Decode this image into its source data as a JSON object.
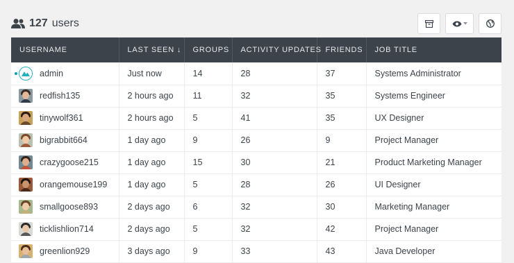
{
  "header": {
    "icon": "users-icon",
    "count": "127",
    "label": "users"
  },
  "toolbar": {
    "buttons": [
      {
        "icon": "archive-icon"
      },
      {
        "icon": "eye-dropdown-icon"
      },
      {
        "icon": "globe-icon"
      }
    ]
  },
  "table": {
    "columns": [
      "USERNAME",
      "LAST SEEN ↓",
      "GROUPS",
      "ACTIVITY UPDATES",
      "FRIENDS",
      "JOB TITLE"
    ],
    "rows": [
      {
        "username": "admin",
        "last_seen": "Just now",
        "groups": "14",
        "activity": "28",
        "friends": "37",
        "job": "Systems Administrator",
        "online": true,
        "avatar": "logo"
      },
      {
        "username": "redfish135",
        "last_seen": "2 hours ago",
        "groups": "11",
        "activity": "32",
        "friends": "35",
        "job": "Systems Engineer",
        "online": false,
        "avatar": "photo"
      },
      {
        "username": "tinywolf361",
        "last_seen": "2 hours ago",
        "groups": "5",
        "activity": "41",
        "friends": "35",
        "job": "UX Designer",
        "online": false,
        "avatar": "photo"
      },
      {
        "username": "bigrabbit664",
        "last_seen": "1 day ago",
        "groups": "9",
        "activity": "26",
        "friends": "9",
        "job": "Project Manager",
        "online": false,
        "avatar": "photo"
      },
      {
        "username": "crazygoose215",
        "last_seen": "1 day ago",
        "groups": "15",
        "activity": "30",
        "friends": "21",
        "job": "Product Marketing Manager",
        "online": false,
        "avatar": "photo"
      },
      {
        "username": "orangemouse199",
        "last_seen": "1 day ago",
        "groups": "5",
        "activity": "28",
        "friends": "26",
        "job": "UI Designer",
        "online": false,
        "avatar": "photo"
      },
      {
        "username": "smallgoose893",
        "last_seen": "2 days ago",
        "groups": "6",
        "activity": "32",
        "friends": "30",
        "job": "Marketing Manager",
        "online": false,
        "avatar": "photo"
      },
      {
        "username": "ticklishlion714",
        "last_seen": "2 days ago",
        "groups": "5",
        "activity": "32",
        "friends": "42",
        "job": "Project Manager",
        "online": false,
        "avatar": "photo"
      },
      {
        "username": "greenlion929",
        "last_seen": "3 days ago",
        "groups": "9",
        "activity": "33",
        "friends": "43",
        "job": "Java Developer",
        "online": false,
        "avatar": "photo"
      }
    ]
  },
  "colors": {
    "header_bg": "#3c434a",
    "accent": "#23b0bf",
    "online": "#00a0b4"
  }
}
